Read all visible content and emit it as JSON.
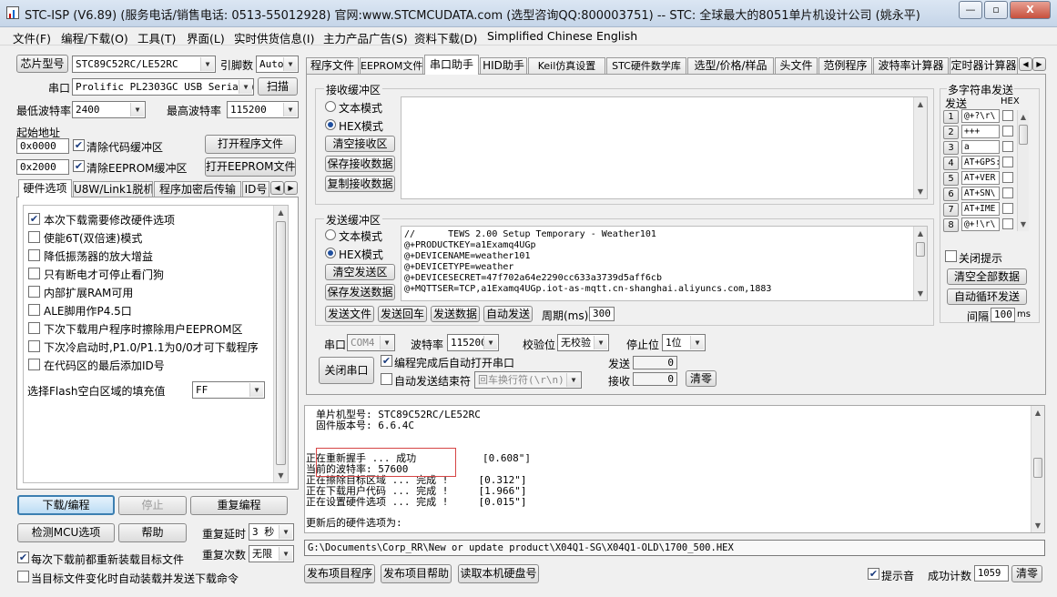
{
  "window": {
    "title": "STC-ISP (V6.89) (服务电话/销售电话: 0513-55012928) 官网:www.STCMCUDATA.com  (选型咨询QQ:800003751) -- STC: 全球最大的8051单片机设计公司 (姚永平)",
    "min_label": "—",
    "max_label": "▫",
    "close_label": "X"
  },
  "menu": [
    "文件(F)",
    "编程/下载(O)",
    "工具(T)",
    "界面(L)",
    "实时供货信息(I)",
    "主力产品广告(S)",
    "资料下载(D)",
    "Simplified Chinese",
    "English"
  ],
  "left": {
    "chip_button": "芯片型号",
    "chip_value": "STC89C52RC/LE52RC",
    "pins_label": "引脚数",
    "pins_value": "Auto",
    "port_label": "串口",
    "port_value": "Prolific PL2303GC USB Serial (",
    "scan_button": "扫描",
    "min_baud_label": "最低波特率",
    "min_baud_value": "2400",
    "max_baud_label": "最高波特率",
    "max_baud_value": "115200",
    "start_addr_label": "起始地址",
    "addr1": "0x0000",
    "clear_code_label": "清除代码缓冲区",
    "open_prog_button": "打开程序文件",
    "addr2": "0x2000",
    "clear_eeprom_label": "清除EEPROM缓冲区",
    "open_eeprom_button": "打开EEPROM文件",
    "tabs": [
      "硬件选项",
      "U8W/Link1脱机",
      "程序加密后传输",
      "ID号"
    ],
    "hw_options": [
      {
        "label": "本次下载需要修改硬件选项",
        "checked": "✔"
      },
      {
        "label": "使能6T(双倍速)模式",
        "checked": ""
      },
      {
        "label": "降低振荡器的放大增益",
        "checked": ""
      },
      {
        "label": "只有断电才可停止看门狗",
        "checked": ""
      },
      {
        "label": "内部扩展RAM可用",
        "checked": ""
      },
      {
        "label": "ALE脚用作P4.5口",
        "checked": ""
      },
      {
        "label": "下次下载用户程序时擦除用户EEPROM区",
        "checked": ""
      },
      {
        "label": "下次冷启动时,P1.0/P1.1为0/0才可下载程序",
        "checked": ""
      },
      {
        "label": "在代码区的最后添加ID号",
        "checked": ""
      }
    ],
    "flash_fill_label": "选择Flash空白区域的填充值",
    "flash_fill_value": "FF",
    "download_button": "下载/编程",
    "stop_button": "停止",
    "reprogram_button": "重复编程",
    "detect_button": "检测MCU选项",
    "help_button": "帮助",
    "repeat_delay_label": "重复延时",
    "repeat_delay_value": "3 秒",
    "repeat_count_label": "重复次数",
    "repeat_count_value": "无限",
    "reload_label": "每次下载前都重新装载目标文件",
    "autoload_label": "当目标文件变化时自动装载并发送下载命令"
  },
  "right_tabs": [
    "程序文件",
    "EEPROM文件",
    "串口助手",
    "HID助手",
    "Keil仿真设置",
    "STC硬件数学库",
    "选型/价格/样品",
    "头文件",
    "范例程序",
    "波特率计算器",
    "定时器计算器"
  ],
  "serial": {
    "recv_title": "接收缓冲区",
    "text_mode": "文本模式",
    "hex_mode": "HEX模式",
    "clear_recv": "清空接收区",
    "save_recv": "保存接收数据",
    "copy_recv": "复制接收数据",
    "send_title": "发送缓冲区",
    "clear_send": "清空发送区",
    "save_send": "保存发送数据",
    "send_lines": [
      "//      TEWS 2.00 Setup Temporary - Weather101",
      "@+PRODUCTKEY=a1Examq4UGp",
      "@+DEVICENAME=weather101",
      "@+DEVICETYPE=weather",
      "@+DEVICESECRET=47f702a64e2290cc633a3739d5aff6cb",
      "@+MQTTSER=TCP,a1Examq4UGp.iot-as-mqtt.cn-shanghai.aliyuncs.com,1883"
    ],
    "send_file": "发送文件",
    "send_enter": "发送回车",
    "send_data": "发送数据",
    "auto_send": "自动发送",
    "period_label": "周期(ms)",
    "period_value": "300",
    "port_label": "串口",
    "port_value": "COM4",
    "baud_label": "波特率",
    "baud_value": "115200",
    "parity_label": "校验位",
    "parity_value": "无校验",
    "stop_label": "停止位",
    "stop_value": "1位",
    "close_port": "关闭串口",
    "auto_open_label": "编程完成后自动打开串口",
    "auto_end_label": "自动发送结束符",
    "end_value": "回车换行符(\\r\\n)",
    "send_count_label": "发送",
    "send_count": "0",
    "recv_count_label": "接收",
    "recv_count": "0",
    "clear_count": "清零"
  },
  "multi": {
    "title": "多字符串发送",
    "send_label": "发送",
    "hex_label": "HEX",
    "items": [
      {
        "num": "1",
        "value": "@+?\\r\\"
      },
      {
        "num": "2",
        "value": "+++"
      },
      {
        "num": "3",
        "value": "a"
      },
      {
        "num": "4",
        "value": "AT+GPS:"
      },
      {
        "num": "5",
        "value": "AT+VER"
      },
      {
        "num": "6",
        "value": "AT+SN\\"
      },
      {
        "num": "7",
        "value": "AT+IME"
      },
      {
        "num": "8",
        "value": "@+!\\r\\"
      }
    ],
    "close_tip": "关闭提示",
    "clear_all": "清空全部数据",
    "auto_loop": "自动循环发送",
    "interval_label": "间隔",
    "interval_value": "100",
    "interval_unit": "ms"
  },
  "log": {
    "lines": [
      "单片机型号: STC89C52RC/LE52RC",
      "固件版本号: 6.6.4C",
      "",
      "",
      "正在重新握手 ... 成功           [0.608\"]",
      "当前的波特率: 57600",
      "正在擦除目标区域 ... 完成 !     [0.312\"]",
      "正在下载用户代码 ... 完成 !     [1.966\"]",
      "正在设置硬件选项 ... 完成 !     [0.015\"]",
      "",
      "更新后的硬件选项为:"
    ]
  },
  "path": "G:\\Documents\\Corp_RR\\New or update product\\X04Q1-SG\\X04Q1-OLD\\1700_500.HEX",
  "bottom": {
    "publish_prog": "发布项目程序",
    "publish_help": "发布项目帮助",
    "read_disk": "读取本机硬盘号",
    "sound_label": "提示音",
    "success_label": "成功计数",
    "success_value": "1059",
    "clear": "清零"
  }
}
